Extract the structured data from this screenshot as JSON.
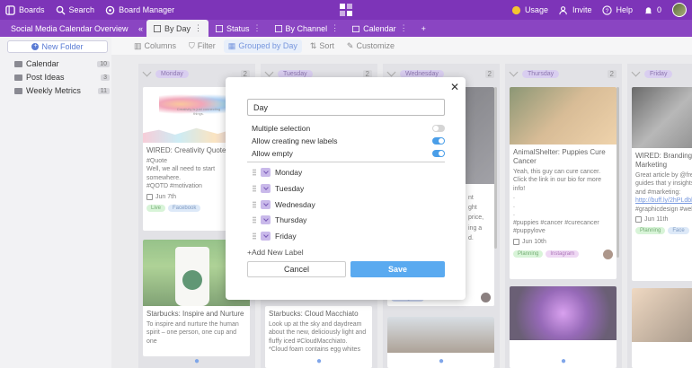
{
  "topbar": {
    "boards": "Boards",
    "search": "Search",
    "board_manager": "Board Manager",
    "usage": "Usage",
    "invite": "Invite",
    "help": "Help",
    "notifications_count": "0"
  },
  "tabs": {
    "board_title": "Social Media Calendar Overview",
    "items": [
      "By Day",
      "Status",
      "By Channel",
      "Calendar"
    ]
  },
  "sidebar": {
    "new_folder": "New Folder",
    "folders": [
      {
        "label": "Calendar",
        "count": "10"
      },
      {
        "label": "Post Ideas",
        "count": "3"
      },
      {
        "label": "Weekly Metrics",
        "count": "11"
      }
    ]
  },
  "toolbar": {
    "columns": "Columns",
    "filter": "Filter",
    "grouped": "Grouped by Day",
    "sort": "Sort",
    "customize": "Customize"
  },
  "columns": [
    {
      "day": "Monday",
      "count": "2"
    },
    {
      "day": "Tuesday",
      "count": "2"
    },
    {
      "day": "Wednesday",
      "count": "2"
    },
    {
      "day": "Thursday",
      "count": "2"
    },
    {
      "day": "Friday",
      "count": "2"
    }
  ],
  "cards": {
    "mon1": {
      "img_text": "Creativity is just connecting things.",
      "title": "WIRED: Creativity Quote",
      "text": "#Quote\nWell, we all need to start somewhere.\n#QOTD #motivation",
      "date": "Jun 7th",
      "tags": [
        "Live",
        "Facebook"
      ]
    },
    "mon2": {
      "title": "Starbucks: Inspire and Nurture",
      "text": "To inspire and nurture the human spirit – one person, one cup and one"
    },
    "tue2": {
      "title": "Starbucks: Cloud Macchiato",
      "text": "Look up at the sky and daydream about the new, deliciously light and fluffy iced #CloudMacchiato.\n*Cloud foam contains egg whites"
    },
    "wed1": {
      "text_fragments": [
        "nt",
        "ght",
        "price,",
        "ing a",
        "d."
      ]
    },
    "wed_tag": "Instagram",
    "thu1": {
      "title": "AnimalShelter: Puppies Cure Cancer",
      "text": "Yeah, this guy can cure cancer. Click the link in our bio for more info!\n.\n.\n.\n#puppies #cancer #curecancer #puppylove",
      "date": "Jun 10th",
      "tags": [
        "Planning",
        "Instagram"
      ]
    },
    "fri1": {
      "title": "WIRED: Branding an Marketing",
      "text": "Great article by @free 100 style guides that y insights into the world and #marketing:",
      "link": "http://buff.ly/2hPLdbb",
      "text2": "#graphicdesign #web #freelancer",
      "date": "Jun 11th",
      "tags": [
        "Planning",
        "Face"
      ]
    }
  },
  "modal": {
    "field_value": "Day",
    "options": [
      {
        "label": "Multiple selection",
        "on": false
      },
      {
        "label": "Allow creating new labels",
        "on": true
      },
      {
        "label": "Allow empty",
        "on": true
      }
    ],
    "labels": [
      "Monday",
      "Tuesday",
      "Wednesday",
      "Thursday",
      "Friday"
    ],
    "add_label": "+Add New Label",
    "cancel": "Cancel",
    "save": "Save"
  },
  "colors": {
    "brand": "#7d34b8",
    "accent": "#5aaaf0",
    "label": "#c9b9ea"
  }
}
